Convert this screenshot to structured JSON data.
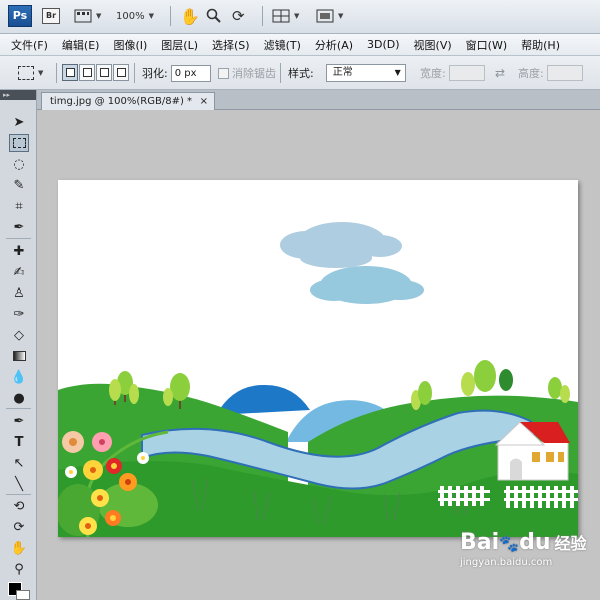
{
  "app": {
    "logo": "Ps",
    "bridge": "Br",
    "zoom": "100%"
  },
  "menu": [
    {
      "label": "文件(F)"
    },
    {
      "label": "编辑(E)"
    },
    {
      "label": "图像(I)"
    },
    {
      "label": "图层(L)"
    },
    {
      "label": "选择(S)"
    },
    {
      "label": "滤镜(T)"
    },
    {
      "label": "分析(A)"
    },
    {
      "label": "3D(D)"
    },
    {
      "label": "视图(V)"
    },
    {
      "label": "窗口(W)"
    },
    {
      "label": "帮助(H)"
    }
  ],
  "options": {
    "feather_label": "羽化:",
    "feather_value": "0 px",
    "antialias_label": "消除锯齿",
    "style_label": "样式:",
    "style_value": "正常",
    "width_label": "宽度:",
    "height_label": "高度:"
  },
  "document": {
    "tab_title": "timg.jpg @ 100%(RGB/8#) *",
    "close": "×"
  },
  "watermark": {
    "brand": "Bai",
    "brand2": "du",
    "product": "经验",
    "url": "jingyan.baidu.com"
  }
}
